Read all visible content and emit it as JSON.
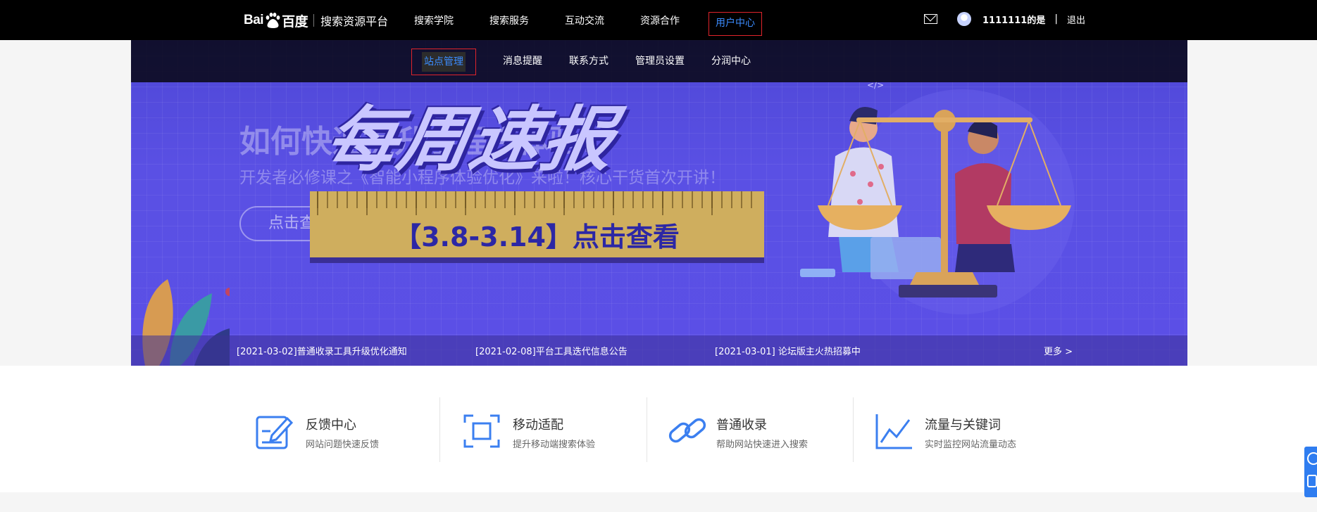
{
  "header": {
    "logo_text": "搜索资源平台",
    "nav": [
      "搜索学院",
      "搜索服务",
      "互动交流",
      "资源合作",
      "用户中心"
    ],
    "active_nav": "用户中心",
    "user_name": "1111111的是",
    "separator": "|",
    "logout": "退出"
  },
  "subnav": {
    "items": [
      "站点管理",
      "消息提醒",
      "联系方式",
      "管理员设置",
      "分润中心"
    ],
    "active": "站点管理"
  },
  "banner": {
    "title": "如何快速提升小程序体验?",
    "subtitle": "开发者必修课之《智能小程序体验优化》来啦！核心干货首次开讲！",
    "button_label": "点击查看",
    "weekly_title": "每周速报",
    "ruler_text": "【3.8-3.14】点击查看",
    "code_tag": "</>"
  },
  "news": {
    "items": [
      "[2021-03-02]普通收录工具升级优化通知",
      "[2021-02-08]平台工具迭代信息公告",
      "[2021-03-01] 论坛版主火热招募中"
    ],
    "more": "更多 >"
  },
  "features": [
    {
      "title": "反馈中心",
      "desc": "网站问题快速反馈",
      "icon": "feedback-icon"
    },
    {
      "title": "移动适配",
      "desc": "提升移动端搜索体验",
      "icon": "mobile-adapt-icon"
    },
    {
      "title": "普通收录",
      "desc": "帮助网站快速进入搜索",
      "icon": "link-icon"
    },
    {
      "title": "流量与关键词",
      "desc": "实时监控网站流量动态",
      "icon": "trend-chart-icon"
    }
  ],
  "colors": {
    "accent": "#3b8cff",
    "highlight_border": "#e0242b",
    "banner_bg": "#5a50e4",
    "icon_blue": "#3b7ff0"
  }
}
